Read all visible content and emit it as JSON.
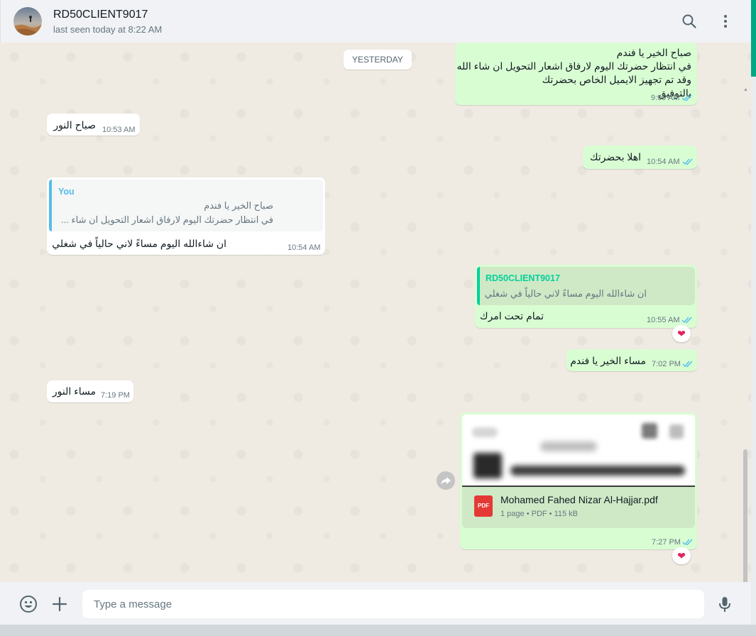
{
  "header": {
    "contact_name": "RD50CLIENT9017",
    "status": "last seen today at 8:22 AM",
    "icons": [
      "avatar",
      "search-icon",
      "menu-icon"
    ]
  },
  "chat": {
    "date_separator": "YESTERDAY",
    "messages": [
      {
        "direction": "out",
        "text": "صباح الخير يا فندم\nفي انتظار حضرتك اليوم لارفاق اشعار التحويل ان شاء الله\nوقد تم تجهيز الايميل الخاص بحضرتك\nبالتوفيق",
        "time": "9:09 AM",
        "status": "read"
      },
      {
        "direction": "in",
        "text": "صباح النور",
        "time": "10:53 AM"
      },
      {
        "direction": "out",
        "text": "اهلا بحضرتك",
        "time": "10:54 AM",
        "status": "read"
      },
      {
        "direction": "in",
        "quote": {
          "author": "You",
          "text": "صباح الخير يا فندم\nفي انتظار حضرتك اليوم لارفاق اشعار التحويل ان شاء ..."
        },
        "text": "ان شاءالله اليوم مساءً لاني حالياً في شغلي",
        "time": "10:54 AM"
      },
      {
        "direction": "out",
        "quote": {
          "author": "RD50CLIENT9017",
          "text": "ان شاءالله اليوم مساءً لاني حالياً في شغلي"
        },
        "text": "تمام تحت امرك",
        "time": "10:55 AM",
        "status": "read",
        "reaction": "❤"
      },
      {
        "direction": "out",
        "text": "مساء الخير يا فندم",
        "time": "7:02 PM",
        "status": "read"
      },
      {
        "direction": "in",
        "text": "مساء النور",
        "time": "7:19 PM"
      },
      {
        "direction": "out",
        "document": {
          "file_name": "Mohamed Fahed Nizar Al-Hajjar.pdf",
          "meta": "1 page • PDF • 115 kB",
          "icon_label": "PDF"
        },
        "time": "7:27 PM",
        "status": "read",
        "reaction": "❤"
      }
    ]
  },
  "composer": {
    "placeholder": "Type a message",
    "icons": [
      "emoji-icon",
      "attach-plus-icon",
      "microphone-icon"
    ]
  },
  "colors": {
    "outgoing_bubble": "#d9fdd3",
    "incoming_bubble": "#ffffff",
    "chat_background": "#efeae2",
    "read_ticks": "#53bdeb",
    "quote_you": "#06cf9c",
    "quote_contact": "#53bdeb",
    "accent": "#00a884"
  }
}
